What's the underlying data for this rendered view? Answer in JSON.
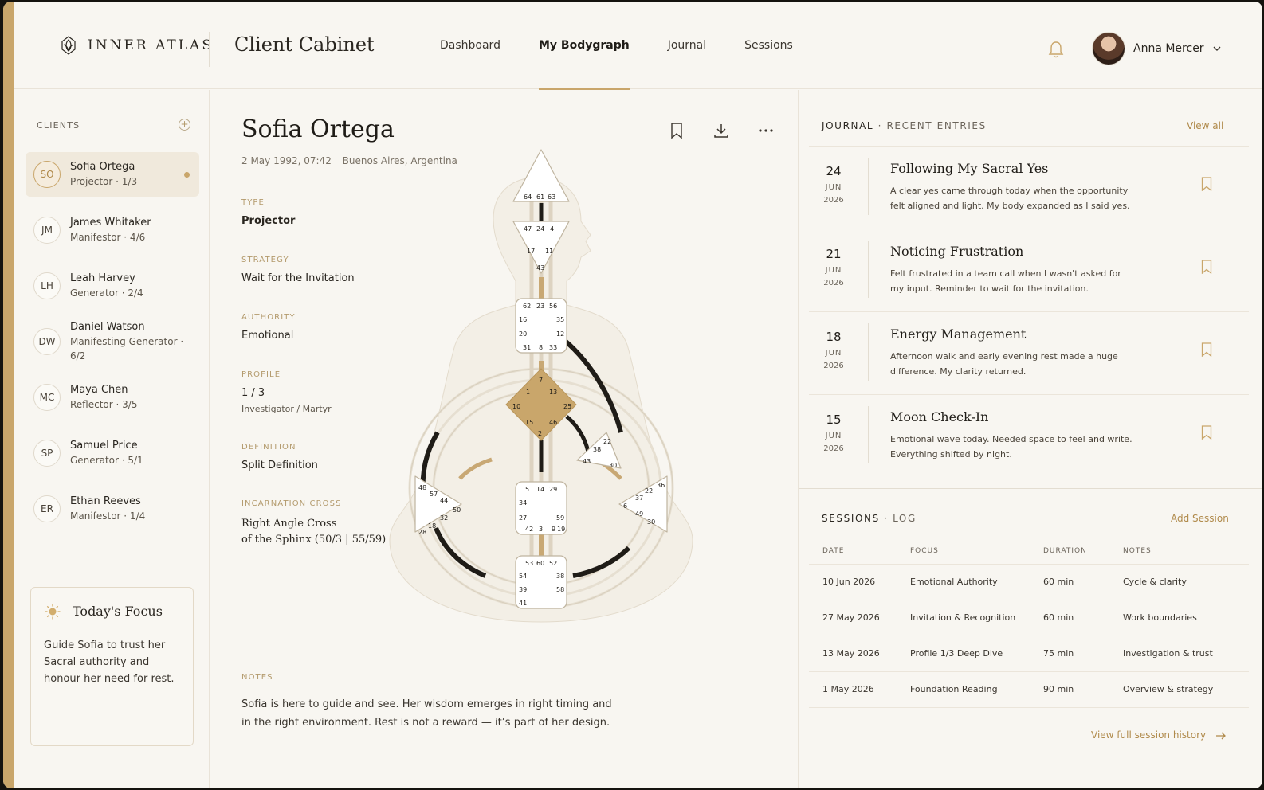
{
  "brand": {
    "logo_text": "INNER ATLAS",
    "app_title": "Client Cabinet",
    "accent": "#c9a66b"
  },
  "nav": {
    "items": [
      {
        "label": "Dashboard"
      },
      {
        "label": "My Bodygraph"
      },
      {
        "label": "Journal"
      },
      {
        "label": "Sessions"
      }
    ],
    "active": "My Bodygraph"
  },
  "user": {
    "name": "Anna Mercer"
  },
  "sidebar": {
    "heading": "CLIENTS",
    "clients": [
      {
        "initials": "SO",
        "name": "Sofia Ortega",
        "sub": "Projector · 1/3"
      },
      {
        "initials": "JM",
        "name": "James Whitaker",
        "sub": "Manifestor · 4/6"
      },
      {
        "initials": "LH",
        "name": "Leah Harvey",
        "sub": "Generator · 2/4"
      },
      {
        "initials": "DW",
        "name": "Daniel Watson",
        "sub": "Manifesting Generator · 6/2"
      },
      {
        "initials": "MC",
        "name": "Maya Chen",
        "sub": "Reflector · 3/5"
      },
      {
        "initials": "SP",
        "name": "Samuel Price",
        "sub": "Generator · 5/1"
      },
      {
        "initials": "ER",
        "name": "Ethan Reeves",
        "sub": "Manifestor · 1/4"
      }
    ],
    "focus": {
      "title": "Today's Focus",
      "text": "Guide Sofia to trust her Sacral authority and honour her need for rest."
    }
  },
  "profile": {
    "name": "Sofia Ortega",
    "birth_date": "2 May 1992, 07:42",
    "birth_place": "Buenos Aires, Argentina",
    "type_label": "TYPE",
    "type": "Projector",
    "strategy_label": "STRATEGY",
    "strategy": "Wait for the Invitation",
    "authority_label": "AUTHORITY",
    "authority": "Emotional",
    "profile_label": "PROFILE",
    "profile": "1 / 3",
    "profile_sub": "Investigator / Martyr",
    "definition_label": "DEFINITION",
    "definition": "Split Definition",
    "cross_label": "INCARNATION CROSS",
    "cross_line1": "Right Angle Cross",
    "cross_line2": "of the Sphinx (50/3 | 55/59)",
    "notes_label": "NOTES",
    "notes": "Sofia is here to guide and see. Her wisdom emerges in right timing and in the right environment. Rest is not a reward — it’s part of her design."
  },
  "bodygraph": {
    "head": [
      "64",
      "61",
      "63"
    ],
    "ajna": [
      "47",
      "24",
      "4",
      "17",
      "11",
      "43"
    ],
    "throat": [
      "62",
      "23",
      "56",
      "16",
      "35",
      "20",
      "12",
      "31",
      "8",
      "33"
    ],
    "g": [
      "7",
      "1",
      "13",
      "10",
      "25",
      "15",
      "46",
      "2"
    ],
    "heart": [
      "22",
      "38",
      "43",
      "30"
    ],
    "spleen": [
      "48",
      "57",
      "44",
      "50",
      "32",
      "18",
      "28"
    ],
    "sacral": [
      "5",
      "14",
      "29",
      "34",
      "27",
      "59",
      "42",
      "3",
      "9",
      "19"
    ],
    "solar": [
      "36",
      "22",
      "37",
      "6",
      "49",
      "30"
    ],
    "root": [
      "53",
      "60",
      "52",
      "54",
      "38",
      "39",
      "58",
      "41"
    ]
  },
  "journal": {
    "heading": "JOURNAL",
    "subheading": "RECENT ENTRIES",
    "view_all": "View all",
    "entries": [
      {
        "day": "24",
        "mon": "JUN",
        "yr": "2026",
        "title": "Following My Sacral Yes",
        "text": "A clear yes came through today when the opportunity felt aligned and light. My body expanded as I said yes."
      },
      {
        "day": "21",
        "mon": "JUN",
        "yr": "2026",
        "title": "Noticing Frustration",
        "text": "Felt frustrated in a team call when I wasn't asked for my input. Reminder to wait for the invitation."
      },
      {
        "day": "18",
        "mon": "JUN",
        "yr": "2026",
        "title": "Energy Management",
        "text": "Afternoon walk and early evening rest made a huge difference. My clarity returned."
      },
      {
        "day": "15",
        "mon": "JUN",
        "yr": "2026",
        "title": "Moon Check-In",
        "text": "Emotional wave today. Needed space to feel and write. Everything shifted by night."
      }
    ]
  },
  "sessions": {
    "heading": "SESSIONS",
    "subheading": "LOG",
    "add": "Add Session",
    "columns": [
      "DATE",
      "FOCUS",
      "DURATION",
      "NOTES"
    ],
    "rows": [
      [
        "10 Jun 2026",
        "Emotional Authority",
        "60 min",
        "Cycle & clarity"
      ],
      [
        "27 May 2026",
        "Invitation & Recognition",
        "60 min",
        "Work boundaries"
      ],
      [
        "13 May 2026",
        "Profile 1/3 Deep Dive",
        "75 min",
        "Investigation & trust"
      ],
      [
        "1 May 2026",
        "Foundation Reading",
        "90 min",
        "Overview & strategy"
      ]
    ],
    "history_link": "View full session history"
  }
}
